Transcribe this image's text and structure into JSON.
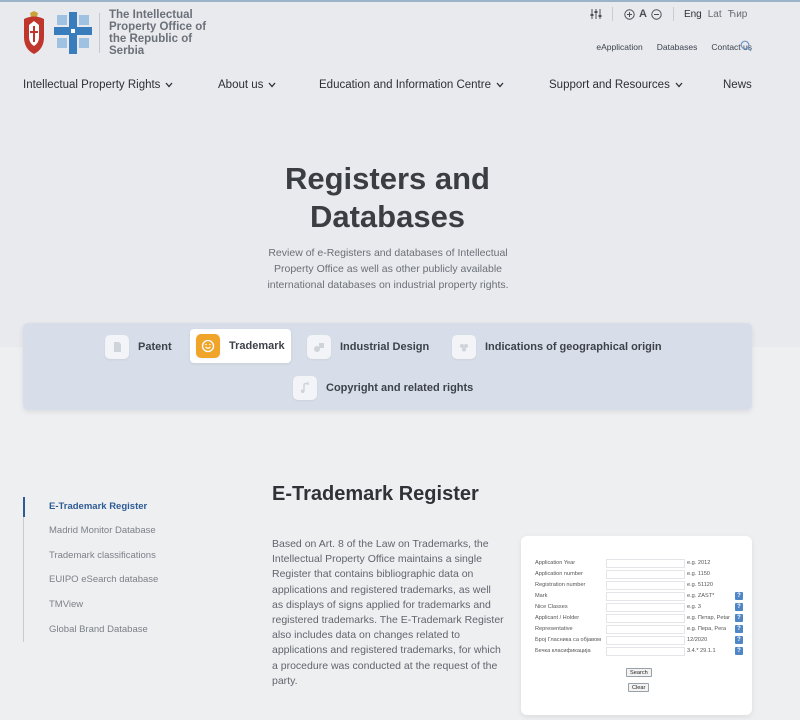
{
  "header": {
    "logo_text": "The Intellectual Property Office of the Republic of Serbia",
    "tools": {
      "settings_icon": "sliders-icon",
      "zoom_in_icon": "plus-circle-icon",
      "font_letter": "A",
      "zoom_out_icon": "minus-circle-icon"
    },
    "languages": [
      "Eng",
      "Lat",
      "Ћир"
    ],
    "util_links": [
      "eApplication",
      "Databases",
      "Contact us"
    ],
    "search_icon": "search-icon"
  },
  "nav": [
    "Intellectual Property Rights",
    "About us",
    "Education and Information Centre",
    "Support and Resources",
    "News"
  ],
  "hero": {
    "title_line1": "Registers and",
    "title_line2": "Databases",
    "subtitle": "Review of e-Registers and databases of Intellectual Property Office as well as other publicly available international databases on industrial property rights."
  },
  "tabs": [
    {
      "label": "Patent",
      "icon": "document-icon"
    },
    {
      "label": "Trademark",
      "icon": "smile-badge-icon"
    },
    {
      "label": "Industrial Design",
      "icon": "shapes-icon"
    },
    {
      "label": "Indications of geographical origin",
      "icon": "grapes-icon"
    },
    {
      "label": "Copyright and related rights",
      "icon": "music-note-icon"
    }
  ],
  "sidebar": {
    "items": [
      "E-Trademark Register",
      "Madrid Monitor Database",
      "Trademark classifications",
      "EUIPO eSearch database",
      "TMView",
      "Global Brand Database"
    ]
  },
  "section": {
    "title": "E-Trademark Register",
    "text": "Based on Art. 8 of the Law on Trademarks, the Intellectual Property Office maintains a single Register that contains bibliographic data on applications and registered trademarks, as well as displays of signs applied for trademarks and registered trademarks. The E-Trademark Register also includes data on changes related to applications and registered trademarks, for which a procedure was conducted at the request of the party."
  },
  "form": {
    "rows": [
      {
        "label": "Application Year",
        "example": "e.g. 2012",
        "help": false
      },
      {
        "label": "Application number",
        "example": "e.g. 1150",
        "help": false
      },
      {
        "label": "Registration number",
        "example": "e.g. 51120",
        "help": false
      },
      {
        "label": "Mark",
        "example": "e.g. ZAST*",
        "help": true
      },
      {
        "label": "Nice Classes",
        "example": "e.g. 3",
        "help": true
      },
      {
        "label": "Applicant / Holder",
        "example": "e.g. Петар, Petar",
        "help": true
      },
      {
        "label": "Representative",
        "example": "e.g. Перa, Pera",
        "help": true
      },
      {
        "label": "Број Гласника са објавом",
        "example": "12/2020",
        "help": true
      },
      {
        "label": "Бечка класификација",
        "example": "3.4.* 29.1.1",
        "help": true
      }
    ],
    "help_mark": "?",
    "search_label": "Search",
    "clear_label": "Clear"
  },
  "colors": {
    "accent_blue": "#2d5b95",
    "trademark_orange": "#f0a52a",
    "tab_bar": "#d8dee9"
  }
}
